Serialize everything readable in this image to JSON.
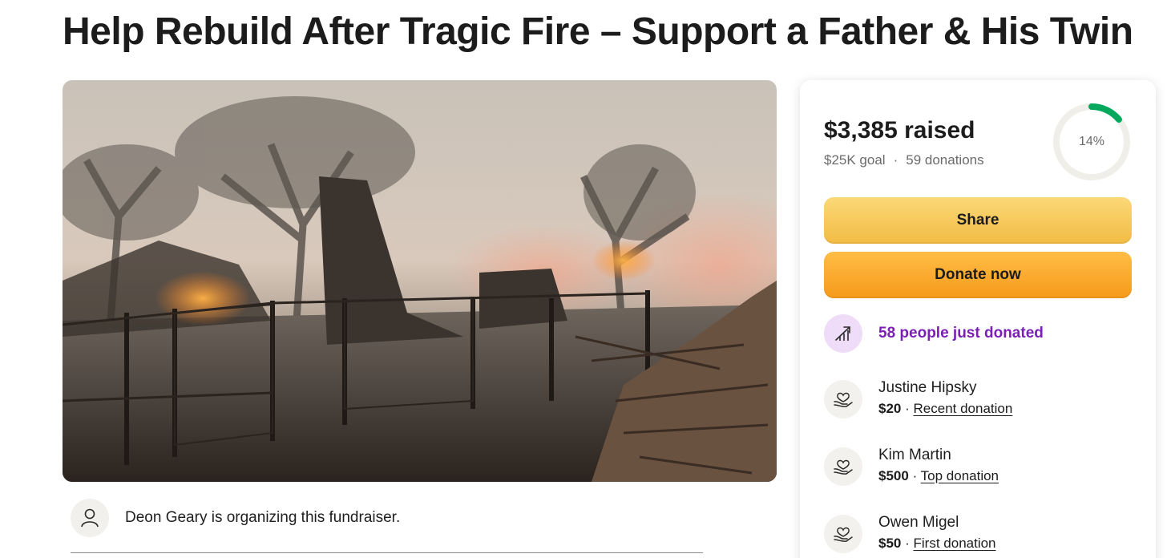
{
  "campaign": {
    "title": "Help Rebuild After Tragic Fire – Support a Father & His Twin",
    "hero_image": "burned-property-after-fire-photo"
  },
  "organizer": {
    "text": "Deon Geary is organizing this fundraiser.",
    "icon": "person-icon"
  },
  "donation_card": {
    "raised": "$3,385 raised",
    "goal": "$25K goal",
    "separator": "·",
    "donations": "59 donations",
    "progress_label": "14%",
    "progress_fraction": 0.14,
    "share_label": "Share",
    "donate_label": "Donate now",
    "trend_text": "58 people just donated",
    "donors": [
      {
        "name": "Justine Hipsky",
        "amount": "$20",
        "tag": "Recent donation"
      },
      {
        "name": "Kim Martin",
        "amount": "$500",
        "tag": "Top donation"
      },
      {
        "name": "Owen Migel",
        "amount": "$50",
        "tag": "First donation"
      }
    ]
  },
  "colors": {
    "accent_green": "#02a95c",
    "share_yellow": "#f6c85c",
    "donate_orange": "#fba82a",
    "trend_purple": "#7b1fb5",
    "trend_bg": "#eedcf8"
  }
}
